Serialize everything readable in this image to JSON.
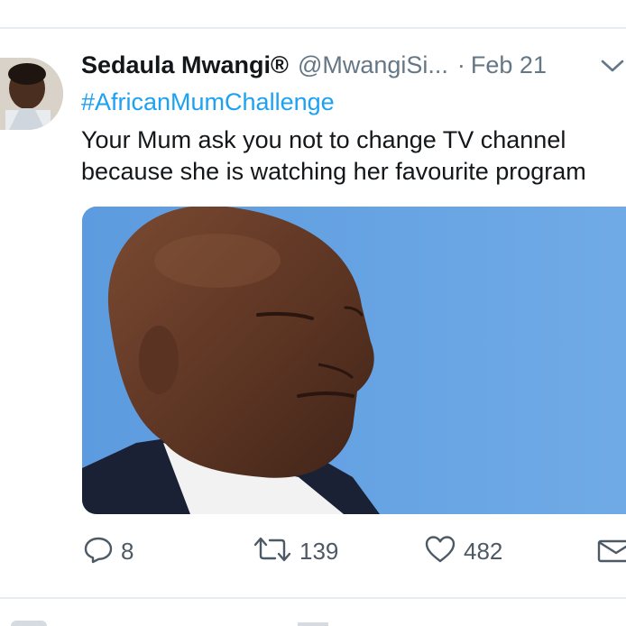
{
  "tweet": {
    "author_name": "Sedaula Mwangi®",
    "handle": "@MwangiSi...",
    "separator": "·",
    "date": "Feb 21",
    "hashtag": "#AfricanMumChallenge",
    "text_line_1": "Your Mum ask you not to change TV channel",
    "text_line_2": "because she is watching her favourite program"
  },
  "actions": {
    "replies": "8",
    "retweets": "139",
    "likes": "482"
  },
  "icons": {
    "reply": "reply-icon",
    "retweet": "retweet-icon",
    "like": "heart-icon",
    "message": "envelope-icon",
    "menu": "chevron-down-icon"
  },
  "colors": {
    "hashtag": "#1da1f2",
    "secondary_text": "#657786",
    "icon": "#4d5a66",
    "divider": "#e6ecf0"
  }
}
